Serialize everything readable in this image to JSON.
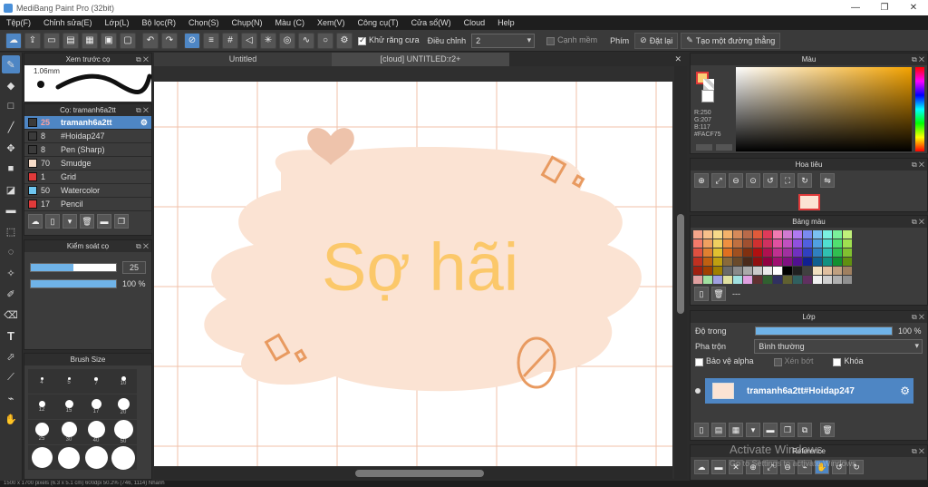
{
  "window": {
    "title": "MediBang Paint Pro (32bit)",
    "minimize": "—",
    "maximize": "❐",
    "close": "✕"
  },
  "menu": [
    "Tệp(F)",
    "Chỉnh sửa(E)",
    "Lớp(L)",
    "Bộ lọc(R)",
    "Chọn(S)",
    "Chụp(N)",
    "Màu (C)",
    "Xem(V)",
    "Công cụ(T)",
    "Cửa sổ(W)",
    "Cloud",
    "Help"
  ],
  "toolbar": {
    "antialias_label": "Khử răng cưa",
    "correction_label": "Điều chỉnh",
    "correction_value": "2",
    "sharp_edge_label": "Cạnh mềm",
    "key_label": "Phím",
    "reset_label": "Đặt lại",
    "straight_line_label": "Tạo một đường thẳng"
  },
  "brush_preview": {
    "title": "Xem trước cọ",
    "size_label": "1.06mm"
  },
  "brush_list": {
    "title": "Cọ: tramanh6a2tt",
    "items": [
      {
        "size": "25",
        "name": "tramanh6a2tt",
        "color": "#3b3b3b",
        "selected": true
      },
      {
        "size": "8",
        "name": "#Hoidap247",
        "color": "#3b3b3b",
        "selected": false
      },
      {
        "size": "8",
        "name": "Pen (Sharp)",
        "color": "#3b3b3b",
        "selected": false
      },
      {
        "size": "70",
        "name": "Smudge",
        "color": "#f7dcc8",
        "selected": false
      },
      {
        "size": "1",
        "name": "Grid",
        "color": "#e03a3a",
        "selected": false
      },
      {
        "size": "50",
        "name": "Watercolor",
        "color": "#6ec6f0",
        "selected": false
      },
      {
        "size": "17",
        "name": "Pencil",
        "color": "#e03a3a",
        "selected": false
      }
    ]
  },
  "brush_control": {
    "title": "Kiểm soát cọ",
    "size_value": "25",
    "opacity_value": "100 %",
    "size_fraction": 0.5,
    "opacity_fraction": 1.0
  },
  "brush_size": {
    "title": "Brush Size",
    "cells": [
      "4",
      "5",
      "7",
      "10",
      "12",
      "15",
      "17",
      "20",
      "25",
      "30",
      "40",
      "50",
      "",
      "",
      "",
      ""
    ]
  },
  "tabs": [
    "Untitled",
    "[cloud] UNTITLED:r2+"
  ],
  "artwork": {
    "text": "Sợ hãi"
  },
  "color_panel": {
    "title": "Màu",
    "r": "R:250",
    "g": "G:207",
    "b": "B:117",
    "hex": "#FACF75",
    "fg_color": "#FACF75"
  },
  "navigator": {
    "title": "Hoa tiêu"
  },
  "palette": {
    "title": "Bảng màu",
    "more": "---",
    "colors": [
      "#f4a58a",
      "#f7c08a",
      "#f7d98a",
      "#f4b26a",
      "#d68a5a",
      "#b86a4a",
      "#e05a3a",
      "#e03a5a",
      "#f07ab0",
      "#d07ad0",
      "#b07af0",
      "#7a8af0",
      "#7ac0f0",
      "#7af0e0",
      "#7af09a",
      "#c0f07a",
      "#f47a6a",
      "#f0a060",
      "#f0d060",
      "#f09040",
      "#c07040",
      "#a05030",
      "#d03030",
      "#d03060",
      "#e050a0",
      "#c050c0",
      "#9050e0",
      "#5060e0",
      "#50a0e0",
      "#50e0d0",
      "#50e070",
      "#a0e050",
      "#e05040",
      "#e08030",
      "#e0c030",
      "#e07020",
      "#a05020",
      "#803010",
      "#b01010",
      "#b01050",
      "#c03090",
      "#a030a0",
      "#7030c0",
      "#3040c0",
      "#3080c0",
      "#30c0b0",
      "#30c050",
      "#80c030",
      "#c03020",
      "#c06010",
      "#c0a010",
      "#8a6a3a",
      "#6a4a2a",
      "#4a2a1a",
      "#901010",
      "#900040",
      "#a01070",
      "#801080",
      "#501090",
      "#102090",
      "#106090",
      "#109080",
      "#109030",
      "#609010",
      "#a02010",
      "#a04000",
      "#a08000",
      "#6a6a6a",
      "#8a8a8a",
      "#aaaaaa",
      "#cacaca",
      "#eaeaea",
      "#ffffff",
      "#000000",
      "#202020",
      "#404040",
      "#f0e0c0",
      "#e0c0a0",
      "#c0a080",
      "#a08060",
      "#e0a0a0",
      "#a0e0a0",
      "#a0a0e0",
      "#e0e0a0",
      "#a0e0e0",
      "#e0a0e0",
      "#603030",
      "#306030",
      "#303060",
      "#606030",
      "#306060",
      "#603060",
      "#f0f0f0",
      "#d0d0d0",
      "#b0b0b0",
      "#909090"
    ]
  },
  "layer_panel": {
    "title": "Lớp",
    "opacity_label": "Độ trong",
    "opacity_value": "100 %",
    "opacity_fraction": 1.0,
    "blend_label": "Pha trộn",
    "blend_value": "Bình thường",
    "protect_alpha": "Bảo vệ alpha",
    "clipping": "Xén bớt",
    "lock": "Khóa",
    "layer_name": "tramanh6a2tt#Hoidap247"
  },
  "reference": {
    "title": "Reference"
  },
  "watermark": {
    "line1": "Activate Windows",
    "line2": "Go to Settings to activate Windows."
  },
  "status": {
    "text": "1500 x 1700 pixels (6.3 x 5.1 cm) 600dpi 50.2% (746, 1114) Nhanh"
  }
}
